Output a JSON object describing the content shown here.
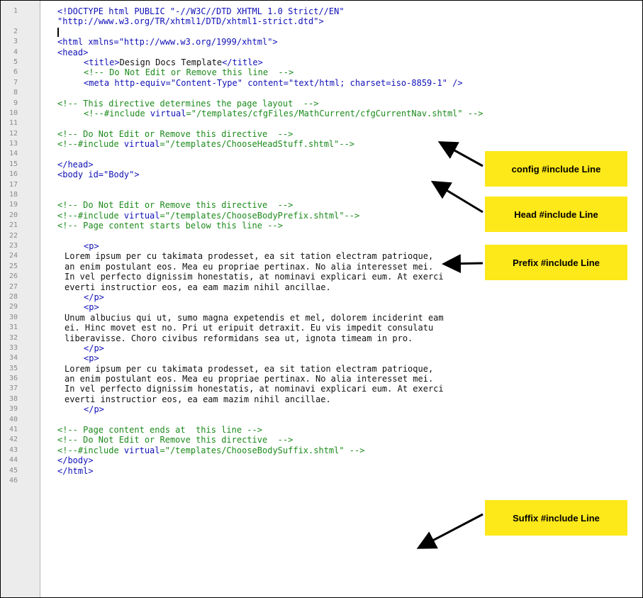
{
  "editor": {
    "lines": [
      {
        "n": "1",
        "segments": [
          {
            "cls": "tag",
            "text": "<!DOCTYPE html PUBLIC \"-//W3C//DTD XHTML 1.0 Strict//EN\""
          }
        ]
      },
      {
        "n": "",
        "segments": [
          {
            "cls": "tag",
            "text": "\"http://www.w3.org/TR/xhtml1/DTD/xhtml1-strict.dtd\">"
          }
        ]
      },
      {
        "n": "2",
        "segments": [],
        "caret": true
      },
      {
        "n": "3",
        "segments": [
          {
            "cls": "tag",
            "text": "<html xmlns=\"http://www.w3.org/1999/xhtml\">"
          }
        ]
      },
      {
        "n": "4",
        "segments": [
          {
            "cls": "tag",
            "text": "<head>"
          }
        ]
      },
      {
        "n": "5",
        "indent": 1,
        "segments": [
          {
            "cls": "tag",
            "text": "<title>"
          },
          {
            "cls": "text",
            "text": "Design Docs Template"
          },
          {
            "cls": "tag",
            "text": "</title>"
          }
        ]
      },
      {
        "n": "6",
        "indent": 1,
        "segments": [
          {
            "cls": "cmt",
            "text": "<!-- Do Not Edit or Remove this line  -->"
          }
        ]
      },
      {
        "n": "7",
        "indent": 1,
        "segments": [
          {
            "cls": "tag",
            "text": "<meta http-equiv=\"Content-Type\" content=\"text/html; charset=iso-8859-1\" />"
          }
        ]
      },
      {
        "n": "8",
        "segments": []
      },
      {
        "n": "9",
        "segments": [
          {
            "cls": "cmt",
            "text": "<!-- This directive determines the page layout  -->"
          }
        ]
      },
      {
        "n": "10",
        "indent": 1,
        "segments": [
          {
            "cls": "cmt",
            "text": "<!--#include "
          },
          {
            "cls": "tag",
            "text": "virtual"
          },
          {
            "cls": "cmt",
            "text": "=\"/templates/cfgFiles/MathCurrent/cfgCurrentNav.shtml\" -->"
          }
        ]
      },
      {
        "n": "11",
        "segments": []
      },
      {
        "n": "12",
        "segments": [
          {
            "cls": "cmt",
            "text": "<!-- Do Not Edit or Remove this directive  -->"
          }
        ]
      },
      {
        "n": "13",
        "segments": [
          {
            "cls": "cmt",
            "text": "<!--#include "
          },
          {
            "cls": "tag",
            "text": "virtual"
          },
          {
            "cls": "cmt",
            "text": "=\"/templates/ChooseHeadStuff.shtml\"-->"
          }
        ]
      },
      {
        "n": "14",
        "segments": []
      },
      {
        "n": "15",
        "segments": [
          {
            "cls": "tag",
            "text": "</head>"
          }
        ]
      },
      {
        "n": "16",
        "segments": [
          {
            "cls": "tag",
            "text": "<body id=\"Body\">"
          }
        ]
      },
      {
        "n": "17",
        "segments": []
      },
      {
        "n": "18",
        "segments": []
      },
      {
        "n": "19",
        "segments": [
          {
            "cls": "cmt",
            "text": "<!-- Do Not Edit or Remove this directive  -->"
          }
        ]
      },
      {
        "n": "20",
        "segments": [
          {
            "cls": "cmt",
            "text": "<!--#include "
          },
          {
            "cls": "tag",
            "text": "virtual"
          },
          {
            "cls": "cmt",
            "text": "=\"/templates/ChooseBodyPrefix.shtml\"-->"
          }
        ]
      },
      {
        "n": "21",
        "segments": [
          {
            "cls": "cmt",
            "text": "<!-- Page content starts below this line -->"
          }
        ]
      },
      {
        "n": "22",
        "segments": []
      },
      {
        "n": "23",
        "indent": 1,
        "segments": [
          {
            "cls": "tag",
            "text": "<p>"
          }
        ]
      },
      {
        "n": "24",
        "indent": 2,
        "segments": [
          {
            "cls": "text",
            "text": "Lorem ipsum per cu takimata prodesset, ea sit tation electram patrioque,"
          }
        ]
      },
      {
        "n": "25",
        "indent": 2,
        "segments": [
          {
            "cls": "text",
            "text": "an enim postulant eos. Mea eu propriae pertinax. No alia interesset mei."
          }
        ]
      },
      {
        "n": "26",
        "indent": 2,
        "segments": [
          {
            "cls": "text",
            "text": "In vel perfecto dignissim honestatis, at nominavi explicari eum. At exerci"
          }
        ]
      },
      {
        "n": "27",
        "indent": 2,
        "segments": [
          {
            "cls": "text",
            "text": "everti instructior eos, ea eam mazim nihil ancillae."
          }
        ]
      },
      {
        "n": "28",
        "indent": 1,
        "segments": [
          {
            "cls": "tag",
            "text": "</p>"
          }
        ]
      },
      {
        "n": "29",
        "indent": 1,
        "segments": [
          {
            "cls": "tag",
            "text": "<p>"
          }
        ]
      },
      {
        "n": "30",
        "indent": 2,
        "segments": [
          {
            "cls": "text",
            "text": "Unum albucius qui ut, sumo magna expetendis et mel, dolorem inciderint eam"
          }
        ]
      },
      {
        "n": "31",
        "indent": 2,
        "segments": [
          {
            "cls": "text",
            "text": "ei. Hinc movet est no. Pri ut eripuit detraxit. Eu vis impedit consulatu"
          }
        ]
      },
      {
        "n": "32",
        "indent": 2,
        "segments": [
          {
            "cls": "text",
            "text": "liberavisse. Choro civibus reformidans sea ut, ignota timeam in pro."
          }
        ]
      },
      {
        "n": "33",
        "indent": 1,
        "segments": [
          {
            "cls": "tag",
            "text": "</p>"
          }
        ]
      },
      {
        "n": "34",
        "indent": 1,
        "segments": [
          {
            "cls": "tag",
            "text": "<p>"
          }
        ]
      },
      {
        "n": "35",
        "indent": 2,
        "segments": [
          {
            "cls": "text",
            "text": "Lorem ipsum per cu takimata prodesset, ea sit tation electram patrioque,"
          }
        ]
      },
      {
        "n": "36",
        "indent": 2,
        "segments": [
          {
            "cls": "text",
            "text": "an enim postulant eos. Mea eu propriae pertinax. No alia interesset mei."
          }
        ]
      },
      {
        "n": "37",
        "indent": 2,
        "segments": [
          {
            "cls": "text",
            "text": "In vel perfecto dignissim honestatis, at nominavi explicari eum. At exerci"
          }
        ]
      },
      {
        "n": "38",
        "indent": 2,
        "segments": [
          {
            "cls": "text",
            "text": "everti instructior eos, ea eam mazim nihil ancillae."
          }
        ]
      },
      {
        "n": "39",
        "indent": 1,
        "segments": [
          {
            "cls": "tag",
            "text": "</p>"
          }
        ]
      },
      {
        "n": "40",
        "segments": []
      },
      {
        "n": "41",
        "segments": [
          {
            "cls": "cmt",
            "text": "<!-- Page content ends at  this line -->"
          }
        ]
      },
      {
        "n": "42",
        "segments": [
          {
            "cls": "cmt",
            "text": "<!-- Do Not Edit or Remove this directive  -->"
          }
        ]
      },
      {
        "n": "43",
        "segments": [
          {
            "cls": "cmt",
            "text": "<!--#include "
          },
          {
            "cls": "tag",
            "text": "virtual"
          },
          {
            "cls": "cmt",
            "text": "=\"/templates/ChooseBodySuffix.shtml\" -->"
          }
        ]
      },
      {
        "n": "44",
        "segments": [
          {
            "cls": "tag",
            "text": "</body>"
          }
        ]
      },
      {
        "n": "45",
        "segments": [
          {
            "cls": "tag",
            "text": "</html>"
          }
        ]
      },
      {
        "n": "46",
        "segments": []
      }
    ]
  },
  "callouts": {
    "config": "config #include Line",
    "head": "Head #include Line",
    "prefix": "Prefix #include Line",
    "suffix": "Suffix #include Line"
  },
  "colors": {
    "tag": "#1010b8",
    "comment": "#1c8a1c",
    "text": "#111111",
    "callout": "#fde81a"
  }
}
